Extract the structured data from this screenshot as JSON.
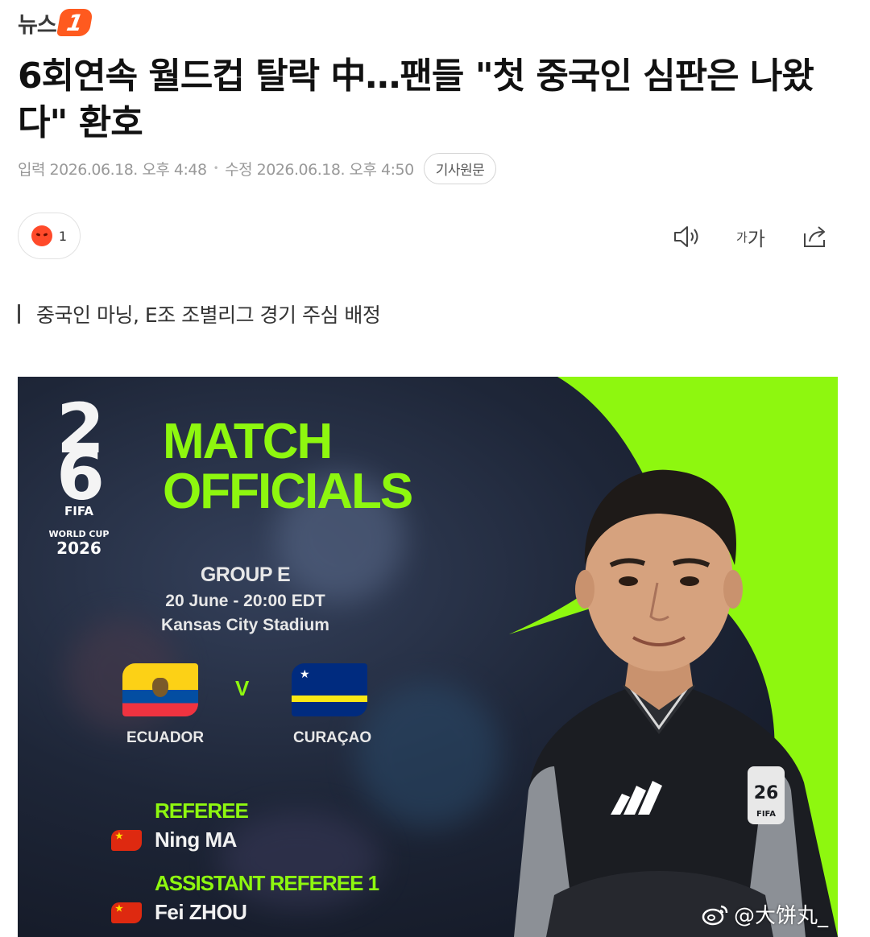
{
  "header": {
    "logo_text": "뉴스",
    "logo_badge": "1"
  },
  "article": {
    "headline": "6회연속 월드컵 탈락 中…팬들 \"첫 중국인 심판은 나왔다\" 환호",
    "meta": {
      "published_label": "입력",
      "published": "2026.06.18. 오후 4:48",
      "modified_label": "수정",
      "modified": "2026.06.18. 오후 4:50",
      "original_button": "기사원문"
    },
    "reaction": {
      "count": "1",
      "icon": "angry-face-icon"
    },
    "tools": {
      "audio_icon": "speaker-icon",
      "font_size_label_small": "가",
      "font_size_label_large": "가",
      "share_icon": "share-icon"
    },
    "subtitle": "중국인 마닝, E조 조별리그 경기 주심 배정"
  },
  "graphic": {
    "logo_fifa": "FIFA",
    "logo_world_cup": "WORLD CUP",
    "logo_year": "2026",
    "title_line1": "MATCH",
    "title_line2": "OFFICIALS",
    "group": "GROUP E",
    "datetime": "20 June - 20:00 EDT",
    "stadium": "Kansas City Stadium",
    "versus": "V",
    "team_home": "ECUADOR",
    "team_away": "CURAÇAO",
    "referee_role": "REFEREE",
    "referee_name": "Ning MA",
    "assistant_role": "ASSISTANT REFEREE 1",
    "assistant_name": "Fei ZHOU",
    "accent_color": "#8ef70f"
  },
  "watermark": {
    "text": "@大饼丸_",
    "icon": "weibo-icon"
  }
}
